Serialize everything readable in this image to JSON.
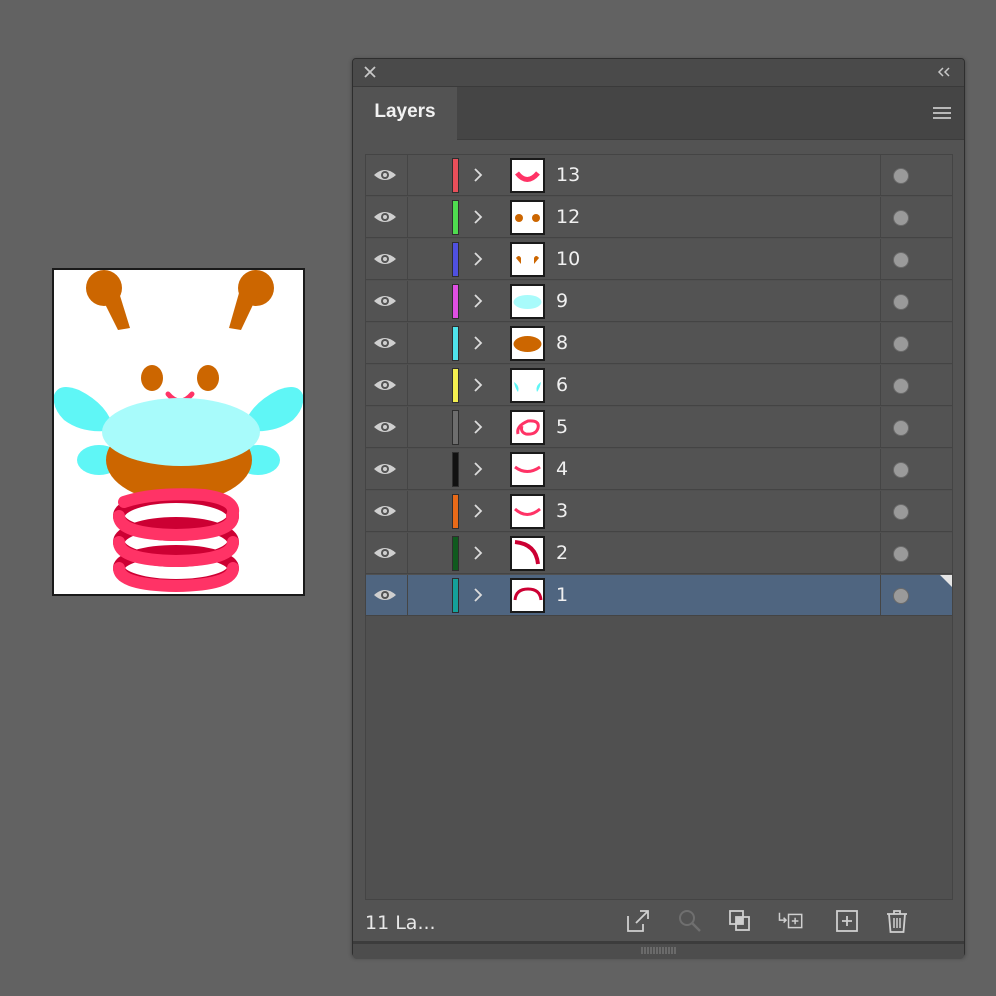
{
  "panel": {
    "tab_label": "Layers",
    "footer_count": "11 La..."
  },
  "layers": [
    {
      "name": "13",
      "color": "#e84f5a"
    },
    {
      "name": "12",
      "color": "#4fdc4f"
    },
    {
      "name": "10",
      "color": "#4f50e0"
    },
    {
      "name": "9",
      "color": "#e04fe4"
    },
    {
      "name": "8",
      "color": "#4fe4ec"
    },
    {
      "name": "6",
      "color": "#f4f050"
    },
    {
      "name": "5",
      "color": "#6d6d6d"
    },
    {
      "name": "4",
      "color": "#111111"
    },
    {
      "name": "3",
      "color": "#e86a18"
    },
    {
      "name": "2",
      "color": "#0f5a1e"
    },
    {
      "name": "1",
      "color": "#14a19a",
      "selected": true
    }
  ],
  "colors": {
    "panel_bg": "#535353",
    "selected_row": "#4f6580",
    "artwork_orange": "#cc6600",
    "artwork_cyan": "#5ff6f6",
    "artwork_light_cyan": "#a8fbfb",
    "artwork_pink": "#ff3366",
    "artwork_dark_pink": "#cc0033"
  },
  "icons": {
    "titlebar": [
      "close-icon",
      "collapse-double-chevron-icon"
    ],
    "menu": "hamburger-menu-icon",
    "row": [
      "eye-icon",
      "chevron-right-icon",
      "target-circle-icon"
    ],
    "footer": [
      "export-icon",
      "locate-object-icon",
      "clipping-mask-icon",
      "new-sublayer-icon",
      "new-layer-icon",
      "trash-icon"
    ]
  }
}
